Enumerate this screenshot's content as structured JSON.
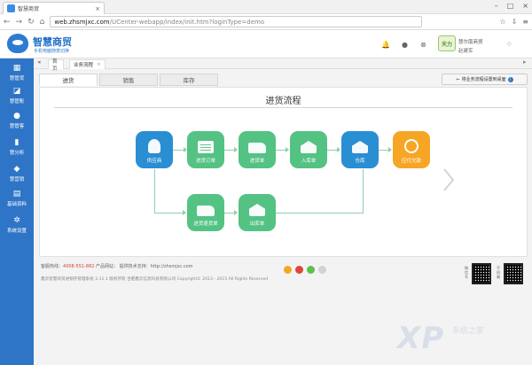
{
  "browser": {
    "tab_title": "智慧商贸",
    "url_host": "web.zhsmjxc.com",
    "url_path": "/UCenter-webapp/index/init.htm?loginType=demo"
  },
  "header": {
    "brand": "智慧商贸",
    "tagline": "手机电脑随意切换",
    "user_logo_text": "天力",
    "company": "慧尔南商贸",
    "username": "赵建军"
  },
  "sidebar": {
    "items": [
      {
        "label": "慧管货"
      },
      {
        "label": "慧管账"
      },
      {
        "label": "慧管客"
      },
      {
        "label": "慧分析"
      },
      {
        "label": "慧营销"
      },
      {
        "label": "基础资料"
      },
      {
        "label": "系统设置"
      }
    ]
  },
  "page_tabs": {
    "home": "首页",
    "flow": "业务流程"
  },
  "subtabs": [
    "进货",
    "销售",
    "库存"
  ],
  "set_start_label": "将业务流程设置到桌面",
  "flow": {
    "title": "进货流程",
    "nodes": {
      "supplier": "供应商",
      "purchase_order": "进货订单",
      "purchase_receipt": "进货单",
      "stock_in": "入库单",
      "warehouse": "仓库",
      "payment": "应付欠款",
      "purchase_return": "进货退货单",
      "stock_out": "出库单"
    },
    "colors": {
      "blue": "#2a8ed3",
      "green": "#54c283",
      "orange": "#f7a525"
    }
  },
  "footer": {
    "hotline_label": "客服热线：",
    "hotline_number": "4008-551-882",
    "product_site": "产品网站：",
    "tech_support": "提供技术支持：http://zhsmjxc.com",
    "copyright": "鑫云智慧商贸进销存管理系统 3.11.1 版权所有 合肥鑫云信息科技有限公司 Copyright© 2013 - 2015 All Rights Reserved",
    "qr_label_1": "微信号",
    "qr_label_2": "手机端"
  },
  "watermark": {
    "main": "XP",
    "sub": "系统之家"
  }
}
